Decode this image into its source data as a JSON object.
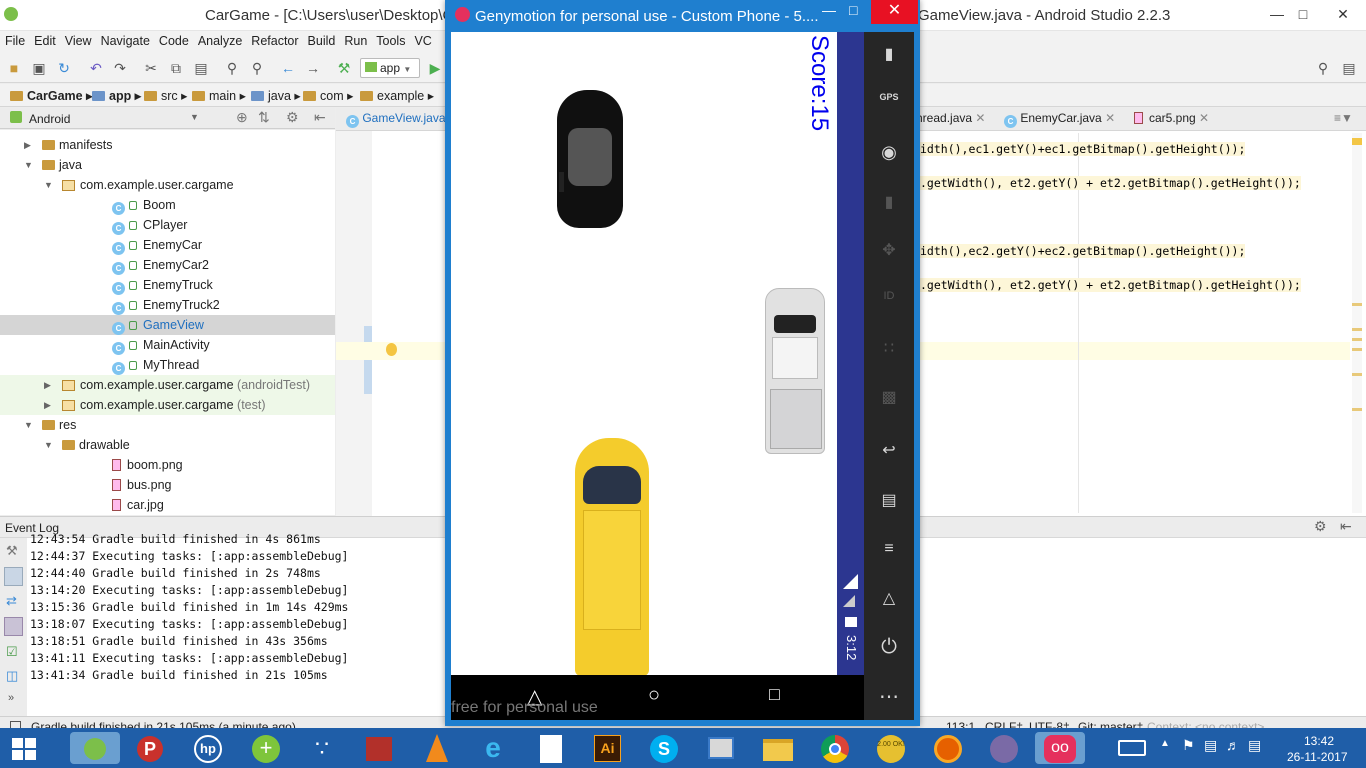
{
  "studio": {
    "title_left": "CarGame - [C:\\Users\\user\\Desktop\\C",
    "title_right": "GameView.java - Android Studio 2.2.3",
    "menu": [
      "File",
      "Edit",
      "View",
      "Navigate",
      "Code",
      "Analyze",
      "Refactor",
      "Build",
      "Run",
      "Tools",
      "VC"
    ],
    "run_config": "app",
    "breadcrumbs": [
      "CarGame",
      "app",
      "src",
      "main",
      "java",
      "com",
      "example"
    ],
    "project_view": "Android",
    "tabs": [
      "GameView.java",
      "hread.java",
      "EnemyCar.java",
      "car5.png"
    ],
    "tree": [
      {
        "label": "manifests",
        "level": 1,
        "kind": "folder",
        "arrow": "▶"
      },
      {
        "label": "java",
        "level": 1,
        "kind": "folder",
        "arrow": "▼"
      },
      {
        "label": "com.example.user.cargame",
        "level": 2,
        "kind": "package",
        "arrow": "▼"
      },
      {
        "label": "Boom",
        "level": 3,
        "kind": "class"
      },
      {
        "label": "CPlayer",
        "level": 3,
        "kind": "class"
      },
      {
        "label": "EnemyCar",
        "level": 3,
        "kind": "class"
      },
      {
        "label": "EnemyCar2",
        "level": 3,
        "kind": "class"
      },
      {
        "label": "EnemyTruck",
        "level": 3,
        "kind": "class"
      },
      {
        "label": "EnemyTruck2",
        "level": 3,
        "kind": "class"
      },
      {
        "label": "GameView",
        "level": 3,
        "kind": "class",
        "selected": true
      },
      {
        "label": "MainActivity",
        "level": 3,
        "kind": "class"
      },
      {
        "label": "MyThread",
        "level": 3,
        "kind": "class"
      },
      {
        "label": "com.example.user.cargame",
        "suffix": "(androidTest)",
        "level": 2,
        "kind": "package",
        "arrow": "▶",
        "green": true
      },
      {
        "label": "com.example.user.cargame",
        "suffix": "(test)",
        "level": 2,
        "kind": "package",
        "arrow": "▶",
        "green": true
      },
      {
        "label": "res",
        "level": 1,
        "kind": "folder",
        "arrow": "▼"
      },
      {
        "label": "drawable",
        "level": 2,
        "kind": "folder",
        "arrow": "▼"
      },
      {
        "label": "boom.png",
        "level": 3,
        "kind": "png"
      },
      {
        "label": "bus.png",
        "level": 3,
        "kind": "png"
      },
      {
        "label": "car.jpg",
        "level": 3,
        "kind": "png"
      }
    ],
    "code_lines": [
      "idth(),ec1.getY()+ec1.getBitmap().getHeight());",
      ".getWidth(), et2.getY() + et2.getBitmap().getHeight());",
      "idth(),ec2.getY()+ec2.getBitmap().getHeight());",
      ".getWidth(), et2.getY() + et2.getBitmap().getHeight());"
    ],
    "event_log_title": "Event Log",
    "log": [
      "12:43:54 Gradle build finished in 4s 861ms",
      "12:44:37 Executing tasks: [:app:assembleDebug]",
      "12:44:40 Gradle build finished in 2s 748ms",
      "13:14:20 Executing tasks: [:app:assembleDebug]",
      "13:15:36 Gradle build finished in 1m 14s 429ms",
      "13:18:07 Executing tasks: [:app:assembleDebug]",
      "13:18:51 Gradle build finished in 43s 356ms",
      "13:41:11 Executing tasks: [:app:assembleDebug]",
      "13:41:34 Gradle build finished in 21s 105ms"
    ],
    "status_msg": "Gradle build finished in 21s 105ms (a minute ago)",
    "status_pos": "113:1",
    "status_crlf": "CRLF‡",
    "status_enc": "UTF-8‡",
    "status_git": "Git: master‡",
    "status_ctx": "Context: <no context>"
  },
  "geny": {
    "title": "Genymotion for personal use - Custom Phone - 5....",
    "score": "Score:15",
    "clock": "3:12",
    "watermark": "free for personal use",
    "gps": "GPS",
    "id": "ID"
  },
  "taskbar": {
    "time": "13:42",
    "date": "26-11-2017",
    "hp": "hp",
    "ai": "Ai",
    "ok": "2.00 OK!"
  }
}
